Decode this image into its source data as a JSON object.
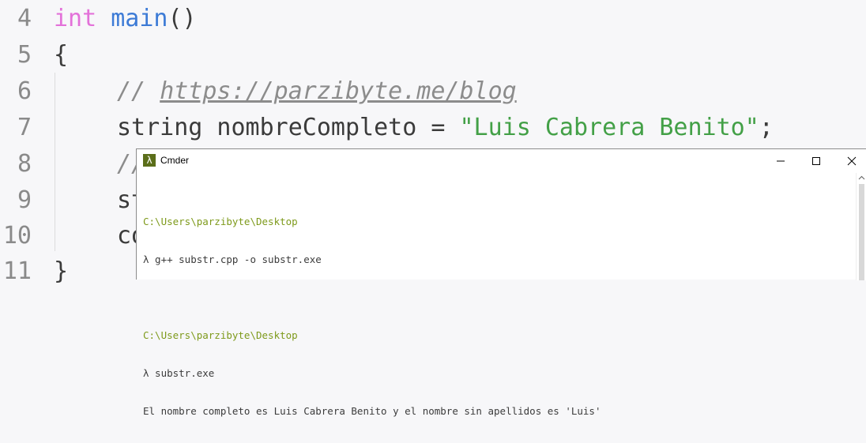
{
  "editor": {
    "lines": [
      {
        "number": "4"
      },
      {
        "number": "5",
        "text": "{"
      },
      {
        "number": "6",
        "comment_slashes": "// ",
        "comment_url": "https://parzibyte.me/blog"
      },
      {
        "number": "7",
        "type": "string",
        "variable": " nombreCompleto = ",
        "string_literal": "\"Luis Cabrera Benito\"",
        "end": ";"
      },
      {
        "number": "8",
        "partial": "//"
      },
      {
        "number": "9",
        "partial": "st"
      },
      {
        "number": "10",
        "partial": "co"
      },
      {
        "number": "11",
        "text": "}"
      }
    ],
    "line4": {
      "keyword": "int",
      "function": "main",
      "parens": "()"
    }
  },
  "cmder": {
    "title": "Cmder",
    "icon": "lambda-icon",
    "console_lines": [
      "C:\\Users\\parzibyte\\Desktop",
      "λ g++ substr.cpp -o substr.exe",
      "C:\\Users\\parzibyte\\Desktop",
      "λ substr.exe",
      "El nombre completo es Luis Cabrera Benito y el nombre sin apellidos es 'Luis'"
    ]
  },
  "colors": {
    "keyword": "#e371d9",
    "function": "#3d7bd6",
    "string": "#43a047",
    "comment": "#8c8c8c",
    "path": "#7e9a1b"
  }
}
